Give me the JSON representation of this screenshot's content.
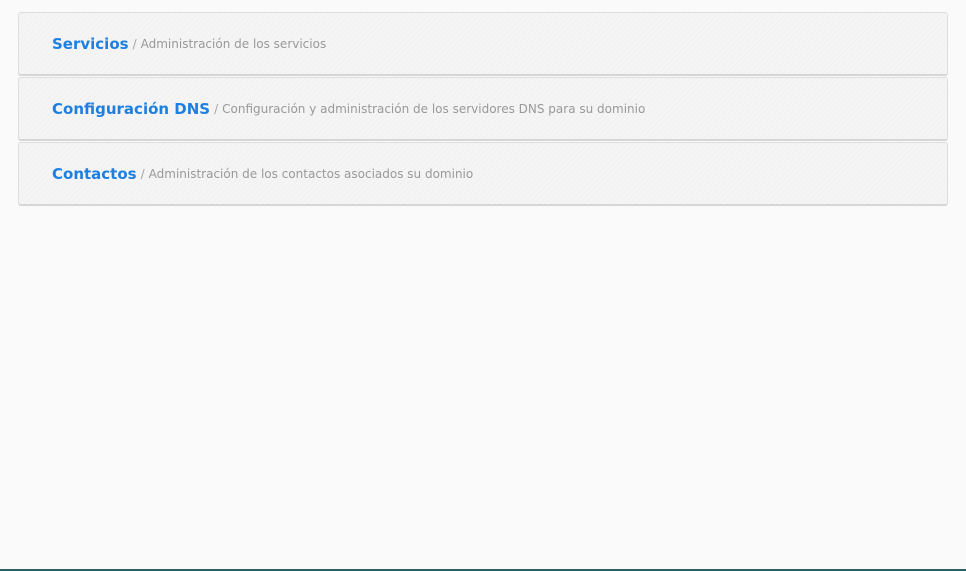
{
  "panels": [
    {
      "title": "Servicios",
      "separator": "/",
      "description": "Administración de los servicios"
    },
    {
      "title": "Configuración DNS",
      "separator": "/",
      "description": "Configuración y administración de los servidores DNS para su dominio"
    },
    {
      "title": "Contactos",
      "separator": "/",
      "description": "Administración de los contactos asociados su dominio"
    }
  ],
  "colors": {
    "title": "#1d7fe0",
    "description": "#999999",
    "background": "#fafafa",
    "bottom_bar": "#2b5f63"
  }
}
